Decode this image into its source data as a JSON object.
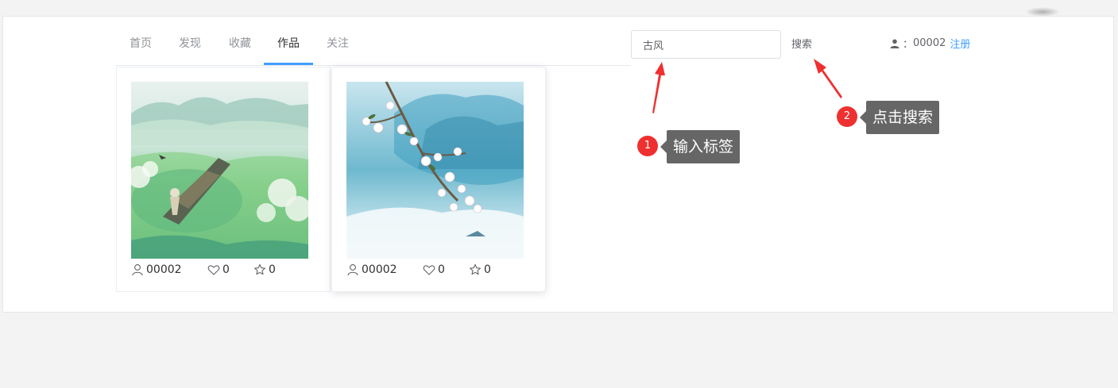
{
  "nav": {
    "tabs": [
      {
        "label": "首页"
      },
      {
        "label": "发现"
      },
      {
        "label": "收藏"
      },
      {
        "label": "作品",
        "active": true
      },
      {
        "label": "关注"
      }
    ]
  },
  "search": {
    "value": "古风",
    "button_label": "搜索"
  },
  "user": {
    "icon": "user-icon",
    "separator": "：",
    "id": "00002",
    "register_label": "注册"
  },
  "works": [
    {
      "author": "00002",
      "likes": "0",
      "favorites": "0",
      "image": "ink-landscape-boat"
    },
    {
      "author": "00002",
      "likes": "0",
      "favorites": "0",
      "image": "blossom-branch-mountains"
    }
  ],
  "annotations": [
    {
      "number": "1",
      "text": "输入标签"
    },
    {
      "number": "2",
      "text": "点击搜索"
    }
  ],
  "colors": {
    "accent": "#409eff",
    "annotation_red": "#ee3030",
    "tooltip_bg": "#666666"
  }
}
